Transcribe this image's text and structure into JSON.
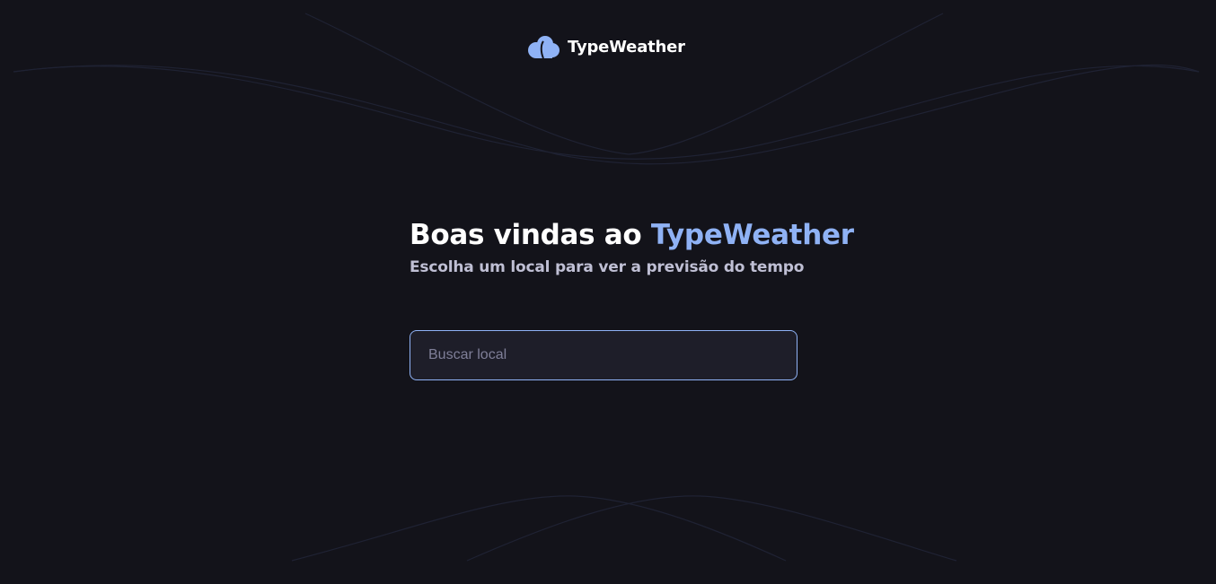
{
  "brand": {
    "name": "TypeWeather",
    "accent_color": "#8fb2f5",
    "background_color": "#13131a"
  },
  "header": {
    "logo_icon": "cloud-icon",
    "logo_text": "TypeWeather"
  },
  "welcome": {
    "title_prefix": "Boas vindas ao ",
    "title_highlight": "TypeWeather",
    "subtitle": "Escolha um local para ver a previsão do tempo"
  },
  "search": {
    "placeholder": "Buscar local",
    "value": ""
  }
}
